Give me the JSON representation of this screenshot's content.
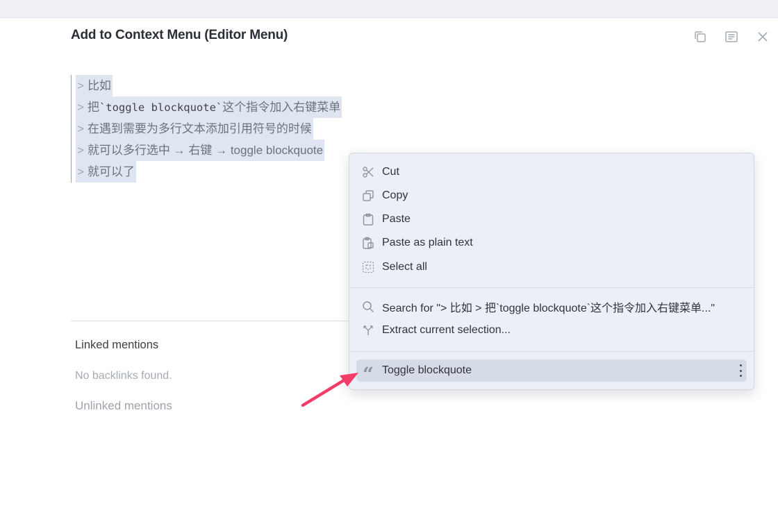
{
  "page": {
    "title": "Add to Context Menu (Editor Menu)"
  },
  "window_icons": [
    "copy-icon",
    "document-icon",
    "close-icon"
  ],
  "editor": {
    "lines": [
      {
        "gt": ">",
        "text": "比如"
      },
      {
        "gt": ">",
        "prefix": "把",
        "code": "`toggle blockquote`",
        "suffix": "这个指令加入右键菜单"
      },
      {
        "gt": ">",
        "text": "在遇到需要为多行文本添加引用符号的时候"
      },
      {
        "gt": ">",
        "text": "就可以多行选中 → 右键 → toggle blockquote"
      },
      {
        "gt": ">",
        "text": "就可以了"
      }
    ]
  },
  "references": {
    "linked_title": "Linked mentions",
    "no_backlinks": "No backlinks found.",
    "unlinked_title": "Unlinked mentions"
  },
  "context_menu": {
    "items": [
      {
        "label": "Cut",
        "icon": "scissors-icon"
      },
      {
        "label": "Copy",
        "icon": "copy-icon"
      },
      {
        "label": "Paste",
        "icon": "clipboard-icon"
      },
      {
        "label": "Paste as plain text",
        "icon": "clipboard-text-icon"
      },
      {
        "label": "Select all",
        "icon": "select-all-icon"
      },
      {
        "label": "Search for \"> 比如 > 把`toggle blockquote`这个指令加入右键菜单...\"",
        "icon": "search-icon"
      },
      {
        "label": "Extract current selection...",
        "icon": "extract-icon"
      },
      {
        "label": "Toggle blockquote",
        "icon": "quote-icon"
      }
    ],
    "highlighted": "Toggle blockquote"
  },
  "annotation": {
    "arrow_color": "#f23d6a"
  },
  "colors": {
    "selection": "#dfe6f2",
    "menu_bg": "#eceff5",
    "menu_highlight": "#d6dce7"
  }
}
